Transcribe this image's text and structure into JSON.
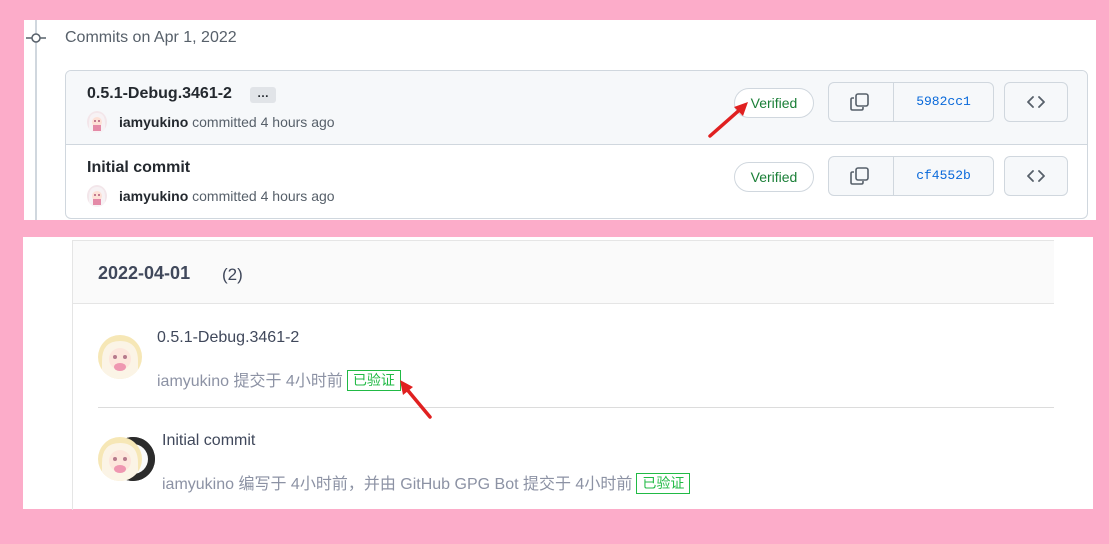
{
  "github": {
    "header": "Commits on Apr 1, 2022",
    "commits": [
      {
        "title": "0.5.1-Debug.3461-2",
        "ellipsis": "…",
        "author": "iamyukino",
        "action": "committed 4 hours ago",
        "badge": "Verified",
        "sha": "5982cc1"
      },
      {
        "title": "Initial commit",
        "author": "iamyukino",
        "action": "committed 4 hours ago",
        "badge": "Verified",
        "sha": "cf4552b"
      }
    ]
  },
  "gitee": {
    "date": "2022-04-01",
    "count": "(2)",
    "commits": [
      {
        "title": "0.5.1-Debug.3461-2",
        "meta": "iamyukino 提交于 4小时前",
        "badge": "已验证"
      },
      {
        "title": "Initial commit",
        "meta": "iamyukino 编写于 4小时前，并由 GitHub GPG Bot 提交于 4小时前",
        "badge": "已验证"
      }
    ]
  },
  "colors": {
    "background": "#fcacc9",
    "verified_green": "#1a7f37",
    "gitee_green": "#21ba45",
    "sha_blue": "#0969da",
    "annotation_arrow": "#e02020"
  },
  "icons": [
    "commit-node-icon",
    "copy-icon",
    "code-icon",
    "arrow-annotation-icon"
  ]
}
